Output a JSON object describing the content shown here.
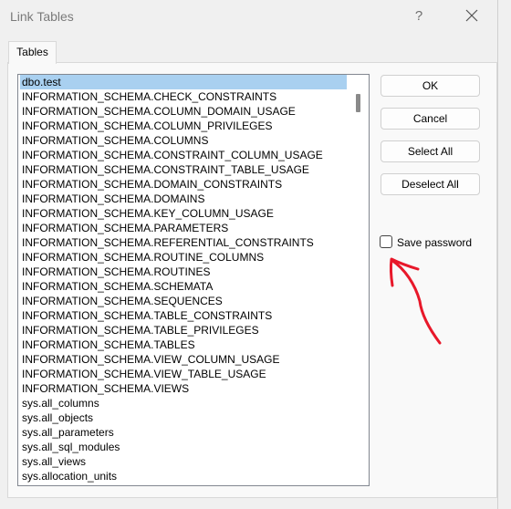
{
  "window": {
    "title": "Link Tables",
    "help_label": "?"
  },
  "tab": {
    "label": "Tables"
  },
  "tables": [
    "dbo.test",
    "INFORMATION_SCHEMA.CHECK_CONSTRAINTS",
    "INFORMATION_SCHEMA.COLUMN_DOMAIN_USAGE",
    "INFORMATION_SCHEMA.COLUMN_PRIVILEGES",
    "INFORMATION_SCHEMA.COLUMNS",
    "INFORMATION_SCHEMA.CONSTRAINT_COLUMN_USAGE",
    "INFORMATION_SCHEMA.CONSTRAINT_TABLE_USAGE",
    "INFORMATION_SCHEMA.DOMAIN_CONSTRAINTS",
    "INFORMATION_SCHEMA.DOMAINS",
    "INFORMATION_SCHEMA.KEY_COLUMN_USAGE",
    "INFORMATION_SCHEMA.PARAMETERS",
    "INFORMATION_SCHEMA.REFERENTIAL_CONSTRAINTS",
    "INFORMATION_SCHEMA.ROUTINE_COLUMNS",
    "INFORMATION_SCHEMA.ROUTINES",
    "INFORMATION_SCHEMA.SCHEMATA",
    "INFORMATION_SCHEMA.SEQUENCES",
    "INFORMATION_SCHEMA.TABLE_CONSTRAINTS",
    "INFORMATION_SCHEMA.TABLE_PRIVILEGES",
    "INFORMATION_SCHEMA.TABLES",
    "INFORMATION_SCHEMA.VIEW_COLUMN_USAGE",
    "INFORMATION_SCHEMA.VIEW_TABLE_USAGE",
    "INFORMATION_SCHEMA.VIEWS",
    "sys.all_columns",
    "sys.all_objects",
    "sys.all_parameters",
    "sys.all_sql_modules",
    "sys.all_views",
    "sys.allocation_units"
  ],
  "selected_table": "dbo.test",
  "buttons": {
    "ok": "OK",
    "cancel": "Cancel",
    "select_all": "Select All",
    "deselect_all": "Deselect All"
  },
  "save_password": {
    "label": "Save password",
    "checked": false
  },
  "colors": {
    "selection": "#a9d0f0",
    "annotation_arrow": "#e8182a"
  },
  "icons": {
    "close": "close-icon",
    "help": "help-icon"
  }
}
